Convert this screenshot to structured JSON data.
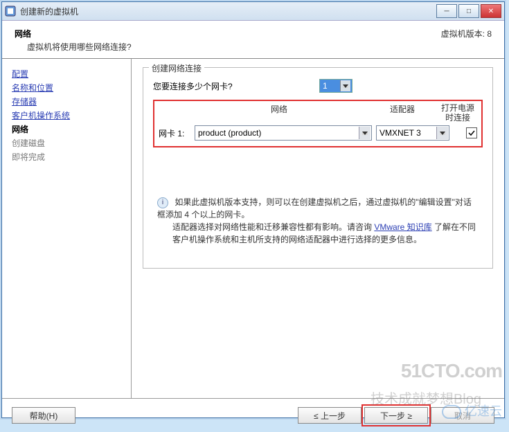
{
  "titlebar": {
    "title": "创建新的虚拟机"
  },
  "header": {
    "heading": "网络",
    "subtitle": "虚拟机将使用哪些网络连接?",
    "version_label": "虚拟机版本: 8"
  },
  "sidebar": {
    "items": [
      {
        "label": "配置",
        "type": "link"
      },
      {
        "label": "名称和位置",
        "type": "link"
      },
      {
        "label": "存储器",
        "type": "link"
      },
      {
        "label": "客户机操作系统",
        "type": "link"
      },
      {
        "label": "网络",
        "type": "current"
      },
      {
        "label": "创建磁盘",
        "type": "future"
      },
      {
        "label": "即将完成",
        "type": "future"
      }
    ]
  },
  "main": {
    "fieldset_legend": "创建网络连接",
    "count_question": "您要连接多少个网卡?",
    "count_value": "1",
    "columns": {
      "network": "网络",
      "adapter": "适配器",
      "power": "打开电源时连接"
    },
    "nic": {
      "label": "网卡 1:",
      "network_value": "product (product)",
      "adapter_value": "VMXNET 3",
      "connect_checked": true
    },
    "info1": "如果此虚拟机版本支持，则可以在创建虚拟机之后，通过虚拟机的\"编辑设置\"对话框添加 4 个以上的网卡。",
    "info2a": "适配器选择对网络性能和迁移兼容性都有影响。请咨询 ",
    "info2_link": "VMware 知识库",
    "info2b": " 了解在不同客户机操作系统和主机所支持的网络适配器中进行选择的更多信息。"
  },
  "footer": {
    "help": "帮助(H)",
    "back": "≤ 上一步",
    "next": "下一步 ≥",
    "cancel": "取消"
  },
  "watermark": {
    "site": "51CTO.com",
    "tech": "技术成就梦想Blog",
    "cloud": "亿速云"
  }
}
